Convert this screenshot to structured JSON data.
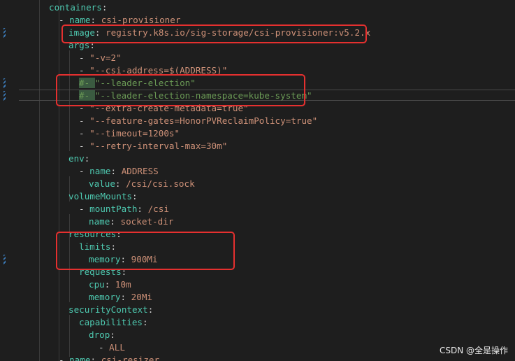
{
  "watermark": "CSDN @全是操作",
  "lines": [
    {
      "k": "containers",
      "sep": ":"
    },
    {
      "dash": "- ",
      "k": "name",
      "sep": ": ",
      "v": "csi-provisioner"
    },
    {
      "k": "image",
      "sep": ": ",
      "v": "registry.k8s.io/sig-storage/csi-provisioner:v5.2.x"
    },
    {
      "k": "args",
      "sep": ":"
    },
    {
      "dash": "- ",
      "v": "\"-v=2\""
    },
    {
      "dash": "- ",
      "v": "\"--csi-address=$(ADDRESS)\""
    },
    {
      "comment": "#- ",
      "v": "\"--leader-election\""
    },
    {
      "comment": "#- ",
      "v": "\"--leader-election-namespace=kube-system\""
    },
    {
      "dash": "- ",
      "v": "\"--extra-create-metadata=true\""
    },
    {
      "dash": "- ",
      "v": "\"--feature-gates=HonorPVReclaimPolicy=true\""
    },
    {
      "dash": "- ",
      "v": "\"--timeout=1200s\""
    },
    {
      "dash": "- ",
      "v": "\"--retry-interval-max=30m\""
    },
    {
      "k": "env",
      "sep": ":"
    },
    {
      "dash": "- ",
      "k": "name",
      "sep": ": ",
      "v": "ADDRESS"
    },
    {
      "k": "value",
      "sep": ": ",
      "v": "/csi/csi.sock"
    },
    {
      "k": "volumeMounts",
      "sep": ":"
    },
    {
      "dash": "- ",
      "k": "mountPath",
      "sep": ": ",
      "v": "/csi"
    },
    {
      "k": "name",
      "sep": ": ",
      "v": "socket-dir"
    },
    {
      "k": "resources",
      "sep": ":"
    },
    {
      "k": "limits",
      "sep": ":"
    },
    {
      "k": "memory",
      "sep": ": ",
      "v": "900Mi"
    },
    {
      "k": "requests",
      "sep": ":"
    },
    {
      "k": "cpu",
      "sep": ": ",
      "v": "10m"
    },
    {
      "k": "memory",
      "sep": ": ",
      "v": "20Mi"
    },
    {
      "k": "securityContext",
      "sep": ":"
    },
    {
      "k": "capabilities",
      "sep": ":"
    },
    {
      "k": "drop",
      "sep": ":"
    },
    {
      "dash": "- ",
      "v": "ALL"
    },
    {
      "dash": "- ",
      "k": "name",
      "sep": ": ",
      "v": "csi-resizer"
    }
  ]
}
